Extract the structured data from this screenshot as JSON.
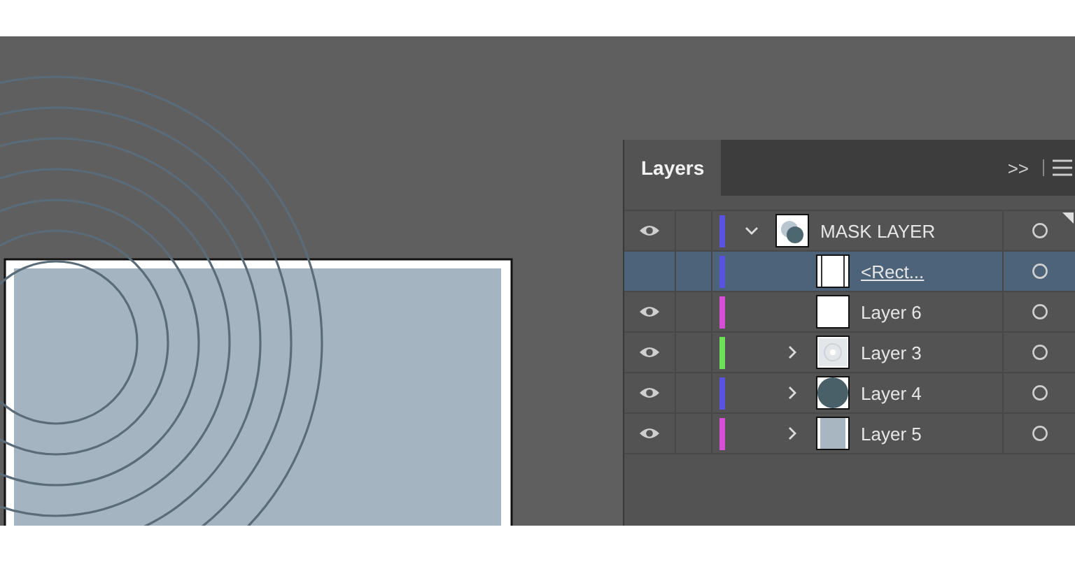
{
  "panel": {
    "tabs": [
      {
        "label": "Layers",
        "selected": true
      }
    ],
    "collapse_label": ">>"
  },
  "layers": [
    {
      "name": "MASK LAYER",
      "visible": true,
      "color": "#5a52e0",
      "expanded": true,
      "kind": "mask",
      "selected": false,
      "children": [
        {
          "name": "<Rect...",
          "visible": false,
          "color": "#5a52e0",
          "kind": "clipping_path",
          "selected": true
        },
        {
          "name": "Layer 6",
          "visible": true,
          "color": "#d64fd6",
          "kind": "blank",
          "selected": false
        },
        {
          "name": "Layer 3",
          "visible": true,
          "color": "#6fe05a",
          "expanded": false,
          "kind": "rings",
          "selected": false
        },
        {
          "name": "Layer 4",
          "visible": true,
          "color": "#5a52e0",
          "expanded": false,
          "kind": "circle",
          "selected": false
        },
        {
          "name": "Layer 5",
          "visible": true,
          "color": "#d64fd6",
          "expanded": false,
          "kind": "rect",
          "selected": false
        }
      ]
    }
  ]
}
